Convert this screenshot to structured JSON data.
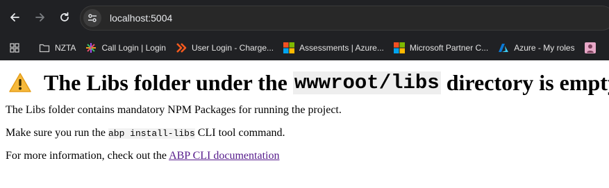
{
  "browser": {
    "url": "localhost:5004",
    "bookmarks": [
      {
        "label": "NZTA",
        "icon": "folder-icon"
      },
      {
        "label": "Call Login | Login",
        "icon": "call-login-icon"
      },
      {
        "label": "User Login - Charge...",
        "icon": "chargebee-icon"
      },
      {
        "label": "Assessments | Azure...",
        "icon": "microsoft-icon"
      },
      {
        "label": "Microsoft Partner C...",
        "icon": "microsoft-icon"
      },
      {
        "label": "Azure - My roles",
        "icon": "azure-icon"
      }
    ]
  },
  "page": {
    "heading_before": "The Libs folder under the",
    "heading_code": "wwwroot/libs",
    "heading_after": "directory is empty!",
    "para1": "The Libs folder contains mandatory NPM Packages for running the project.",
    "para2_before": "Make sure you run the",
    "para2_code": "abp install-libs",
    "para2_after": "CLI tool command.",
    "para3_before": "For more information, check out the",
    "para3_link": "ABP CLI documentation"
  }
}
